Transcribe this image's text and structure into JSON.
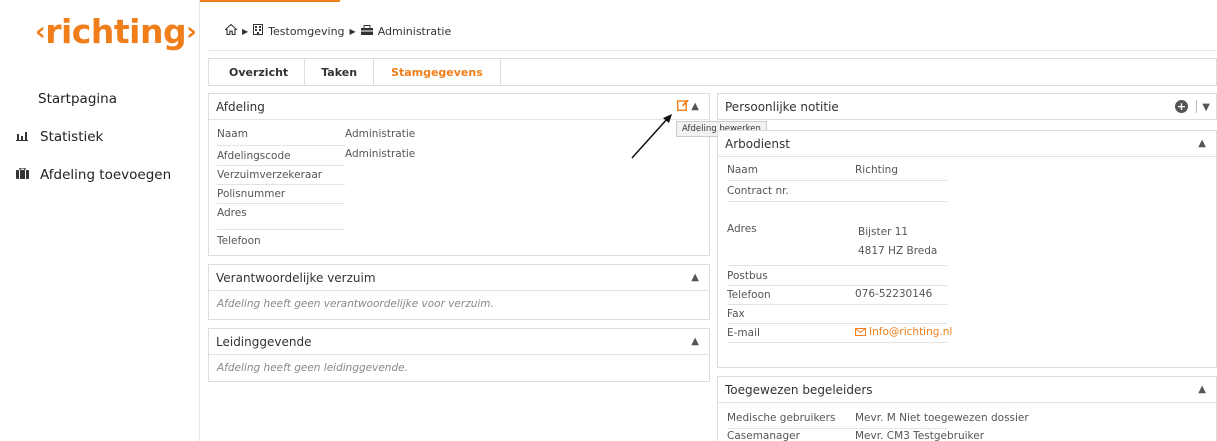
{
  "logo": {
    "text": "richting",
    "left_chev": "‹",
    "right_chev": "›"
  },
  "sidebar": {
    "items": [
      {
        "label": "Startpagina",
        "icon": ""
      },
      {
        "label": "Statistiek",
        "icon": "bar-chart-icon"
      },
      {
        "label": "Afdeling toevoegen",
        "icon": "briefcase-icon"
      }
    ]
  },
  "breadcrumb": {
    "home_icon": "home-icon",
    "items": [
      "Testomgeving",
      "Administratie"
    ]
  },
  "tabs": [
    {
      "label": "Overzicht",
      "active": false
    },
    {
      "label": "Taken",
      "active": false
    },
    {
      "label": "Stamgegevens",
      "active": true
    }
  ],
  "afdeling": {
    "title": "Afdeling",
    "tooltip": "Afdeling bewerken",
    "fields": [
      {
        "label": "Naam",
        "value": "Administratie"
      },
      {
        "label": "Afdelingscode",
        "value": "Administratie"
      },
      {
        "label": "Verzuimverzekeraar",
        "value": ""
      },
      {
        "label": "Polisnummer",
        "value": ""
      },
      {
        "label": "Adres",
        "value": ""
      },
      {
        "label": "Telefoon",
        "value": ""
      }
    ]
  },
  "verantwoordelijke": {
    "title": "Verantwoordelijke verzuim",
    "empty": "Afdeling heeft geen verantwoordelijke voor verzuim."
  },
  "leidinggevende": {
    "title": "Leidinggevende",
    "empty": "Afdeling heeft geen leidinggevende."
  },
  "notitie": {
    "title": "Persoonlijke notitie"
  },
  "arbodienst": {
    "title": "Arbodienst",
    "naam_label": "Naam",
    "naam_value": "Richting",
    "contract_label": "Contract nr.",
    "adres_label": "Adres",
    "adres_line1": "Bijster 11",
    "adres_line2": "4817 HZ Breda",
    "postbus_label": "Postbus",
    "telefoon_label": "Telefoon",
    "telefoon_value": "076-52230146",
    "fax_label": "Fax",
    "email_label": "E-mail",
    "email_value": "Info@richting.nl"
  },
  "begeleiders": {
    "title": "Toegewezen begeleiders",
    "rows": [
      {
        "label": "Medische gebruikers",
        "value": "Mevr. M Niet toegewezen dossier"
      },
      {
        "label": "Casemanager",
        "value": "Mevr. CM3 Testgebruiker"
      }
    ]
  },
  "colors": {
    "accent": "#f07e1a"
  }
}
